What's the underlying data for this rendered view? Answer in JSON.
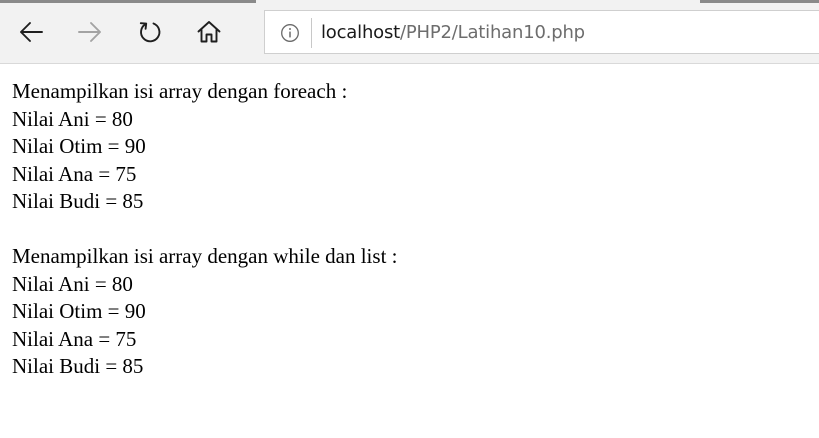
{
  "browser": {
    "nav": {
      "back_icon": "back-arrow-icon",
      "forward_icon": "forward-arrow-icon",
      "refresh_icon": "refresh-icon",
      "home_icon": "home-icon"
    },
    "address_bar": {
      "info_icon": "info-icon",
      "url_host": "localhost",
      "url_path": "/PHP2/Latihan10.php"
    }
  },
  "page": {
    "section1": {
      "heading": "Menampilkan isi array dengan foreach :",
      "items": [
        "Nilai Ani = 80",
        "Nilai Otim = 90",
        "Nilai Ana = 75",
        "Nilai Budi = 85"
      ]
    },
    "section2": {
      "heading": "Menampilkan isi array dengan while dan list :",
      "items": [
        "Nilai Ani = 80",
        "Nilai Otim = 90",
        "Nilai Ana = 75",
        "Nilai Budi = 85"
      ]
    }
  }
}
